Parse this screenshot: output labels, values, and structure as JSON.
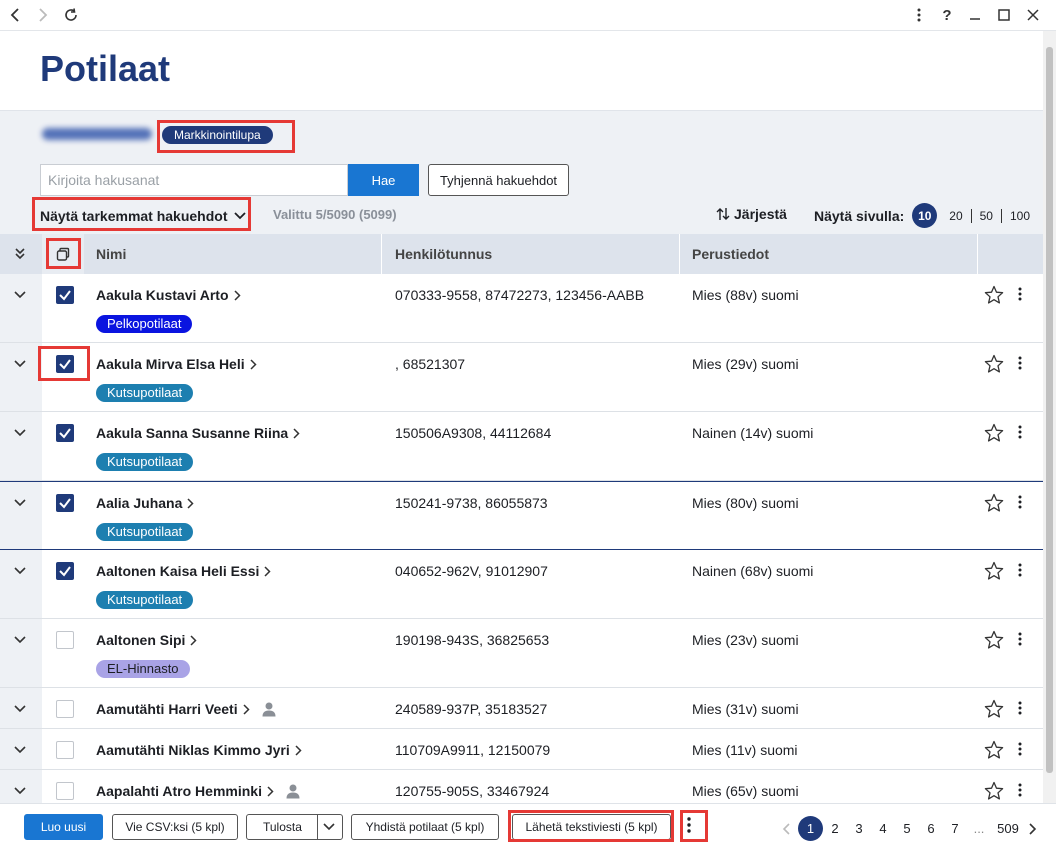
{
  "titlebar": {
    "help": "?"
  },
  "page": {
    "title": "Potilaat"
  },
  "filters": {
    "tag": "Markkinointilupa",
    "search_placeholder": "Kirjoita hakusanat",
    "search_button": "Hae",
    "clear_button": "Tyhjennä hakuehdot",
    "advanced": "Näytä tarkemmat hakuehdot",
    "selected": "Valittu 5/5090 (5099)",
    "sort": "Järjestä",
    "per_page_label": "Näytä sivulla:",
    "per_page_options": [
      "10",
      "20",
      "50",
      "100"
    ],
    "per_page_active": "10"
  },
  "table": {
    "columns": [
      "Nimi",
      "Henkilötunnus",
      "Perustiedot"
    ],
    "rows": [
      {
        "name": "Aakula Kustavi Arto",
        "hetu": "070333-9558, 87472273, 123456-AABB",
        "info": "Mies (88v) suomi",
        "tag": "Pelkopotilaat",
        "tag_color": "#0a14e0",
        "checked": true,
        "person": false
      },
      {
        "name": "Aakula Mirva Elsa Heli",
        "hetu": ", 68521307",
        "info": "Mies (29v) suomi",
        "tag": "Kutsupotilaat",
        "tag_color": "#1d7fb0",
        "checked": true,
        "person": false
      },
      {
        "name": "Aakula Sanna Susanne Riina",
        "hetu": "150506A9308, 44112684",
        "info": "Nainen (14v) suomi",
        "tag": "Kutsupotilaat",
        "tag_color": "#1d7fb0",
        "checked": true,
        "person": false
      },
      {
        "name": "Aalia Juhana",
        "hetu": "150241-9738, 86055873",
        "info": "Mies (80v) suomi",
        "tag": "Kutsupotilaat",
        "tag_color": "#1d7fb0",
        "checked": true,
        "person": false
      },
      {
        "name": "Aaltonen Kaisa Heli Essi",
        "hetu": "040652-962V, 91012907",
        "info": "Nainen (68v) suomi",
        "tag": "Kutsupotilaat",
        "tag_color": "#1d7fb0",
        "checked": true,
        "person": false
      },
      {
        "name": "Aaltonen Sipi",
        "hetu": "190198-943S, 36825653",
        "info": "Mies (23v) suomi",
        "tag": "EL-Hinnasto",
        "tag_color": "#a9a3e6",
        "checked": false,
        "person": false
      },
      {
        "name": "Aamutähti Harri Veeti",
        "hetu": "240589-937P, 35183527",
        "info": "Mies (31v) suomi",
        "tag": "",
        "tag_color": "",
        "checked": false,
        "person": true
      },
      {
        "name": "Aamutähti Niklas Kimmo Jyri",
        "hetu": "110709A9911, 12150079",
        "info": "Mies (11v) suomi",
        "tag": "",
        "tag_color": "",
        "checked": false,
        "person": false
      },
      {
        "name": "Aapalahti Atro Hemminki",
        "hetu": "120755-905S, 33467924",
        "info": "Mies (65v) suomi",
        "tag": "",
        "tag_color": "",
        "checked": false,
        "person": true
      }
    ]
  },
  "footer": {
    "new": "Luo uusi",
    "csv": "Vie CSV:ksi (5 kpl)",
    "print": "Tulosta",
    "merge": "Yhdistä potilaat (5 kpl)",
    "sms": "Lähetä tekstiviesti (5 kpl)",
    "pages": [
      "1",
      "2",
      "3",
      "4",
      "5",
      "6",
      "7",
      "...",
      "509"
    ],
    "current_page": "1"
  },
  "colors": {
    "primary": "#1f3a7a",
    "accent": "#1976d2",
    "highlight": "#e53935"
  }
}
